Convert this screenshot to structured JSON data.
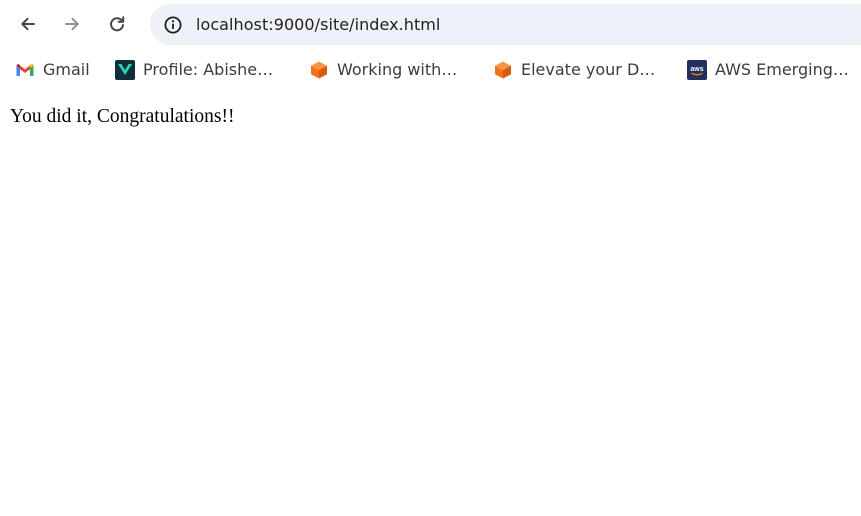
{
  "toolbar": {
    "back_icon": "arrow-left-icon",
    "forward_icon": "arrow-right-icon",
    "reload_icon": "reload-icon"
  },
  "omnibox": {
    "site_info_icon": "info-icon",
    "url": "localhost:9000/site/index.html"
  },
  "bookmarks": [
    {
      "label": "Gmail",
      "icon": "gmail-icon"
    },
    {
      "label": "Profile: Abishe…",
      "icon": "profile-site-icon"
    },
    {
      "label": "Working with…",
      "icon": "cube-icon"
    },
    {
      "label": "Elevate your D…",
      "icon": "cube-icon"
    },
    {
      "label": "AWS Emerging…",
      "icon": "aws-icon"
    }
  ],
  "page": {
    "text": "You did it, Congratulations!!"
  },
  "colors": {
    "omnibox_bg": "#eef1f8",
    "icon_gray": "#444746",
    "icon_disabled": "#8e9196",
    "cube_orange": "#f2711c",
    "aws_navy": "#232f5f"
  }
}
